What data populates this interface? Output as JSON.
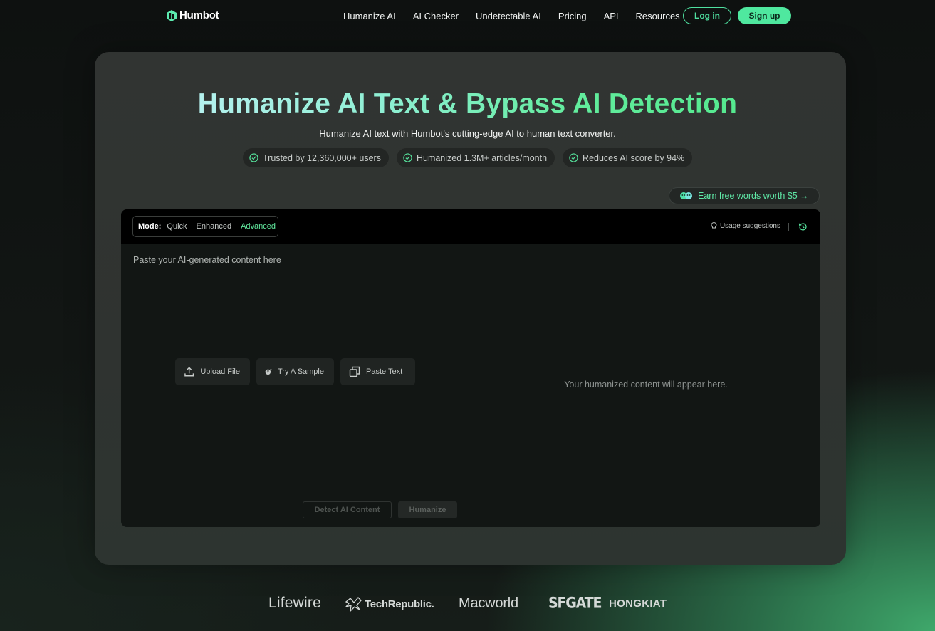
{
  "brand": {
    "name": "Humbot",
    "accent": "#4fe89f"
  },
  "nav": {
    "links": [
      "Humanize AI",
      "AI Checker",
      "Undetectable AI",
      "Pricing",
      "API",
      "Resources"
    ],
    "login": "Log in",
    "signup": "Sign up"
  },
  "hero": {
    "title": "Humanize AI Text & Bypass AI Detection",
    "subtitle": "Humanize AI text with Humbot's cutting-edge AI to human text converter.",
    "badges": [
      "Trusted by 12,360,000+ users",
      "Humanized 1.3M+ articles/month",
      "Reduces AI score by 94%"
    ],
    "earn": "Earn free words worth $5 →"
  },
  "editor": {
    "mode_label": "Mode:",
    "modes": [
      "Quick",
      "Enhanced",
      "Advanced"
    ],
    "active_mode": "Advanced",
    "usage_suggestions": "Usage suggestions",
    "input_placeholder": "Paste your AI-generated content here",
    "actions": {
      "upload": "Upload File",
      "sample": "Try A Sample",
      "paste": "Paste Text"
    },
    "detect_button": "Detect AI Content",
    "humanize_button": "Humanize",
    "output_placeholder": "Your humanized content will appear here."
  },
  "press": [
    "Lifewire",
    "TechRepublic.",
    "Macworld",
    "SFGATE",
    "HONGKIAT"
  ]
}
